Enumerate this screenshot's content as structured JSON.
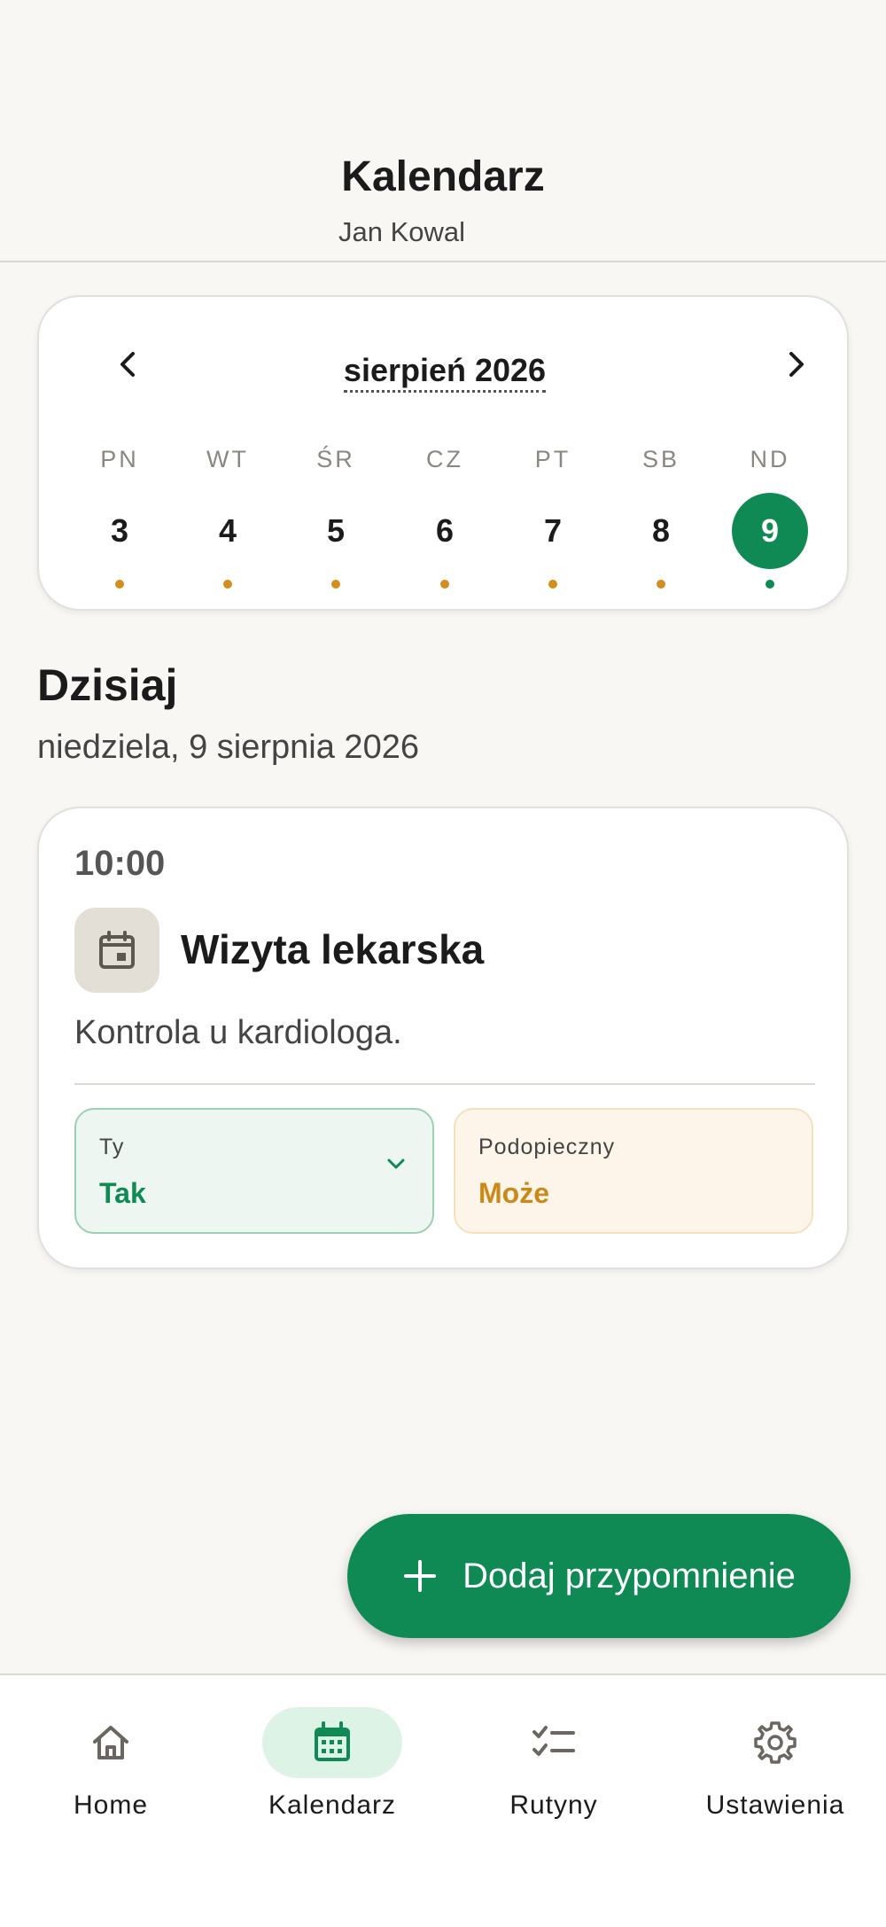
{
  "header": {
    "title": "Kalendarz",
    "subtitle": "Jan Kowal"
  },
  "calendar": {
    "month_label": "sierpień 2026",
    "days": [
      {
        "name": "PN",
        "number": "3",
        "has_event": true
      },
      {
        "name": "WT",
        "number": "4",
        "has_event": true
      },
      {
        "name": "ŚR",
        "number": "5",
        "has_event": true
      },
      {
        "name": "CZ",
        "number": "6",
        "has_event": true
      },
      {
        "name": "PT",
        "number": "7",
        "has_event": true
      },
      {
        "name": "SB",
        "number": "8",
        "has_event": true
      },
      {
        "name": "ND",
        "number": "9",
        "has_event": true,
        "selected": true
      }
    ]
  },
  "today": {
    "title": "Dzisiaj",
    "date": "niedziela, 9 sierpnia 2026"
  },
  "event": {
    "time": "10:00",
    "icon": "calendar-icon",
    "title": "Wizyta lekarska",
    "description": "Kontrola u kardiologa.",
    "you": {
      "label": "Ty",
      "value": "Tak"
    },
    "ward": {
      "label": "Podopieczny",
      "value": "Może"
    }
  },
  "fab": {
    "label": "Dodaj przypomnienie",
    "icon": "plus-icon"
  },
  "nav": {
    "items": [
      {
        "label": "Home",
        "icon": "home-icon"
      },
      {
        "label": "Kalendarz",
        "icon": "calendar-icon",
        "active": true
      },
      {
        "label": "Rutyny",
        "icon": "checklist-icon"
      },
      {
        "label": "Ustawienia",
        "icon": "gear-icon"
      }
    ]
  },
  "colors": {
    "accent": "#0f8a55",
    "maybe": "#c98a1a",
    "background": "#f8f7f4"
  }
}
